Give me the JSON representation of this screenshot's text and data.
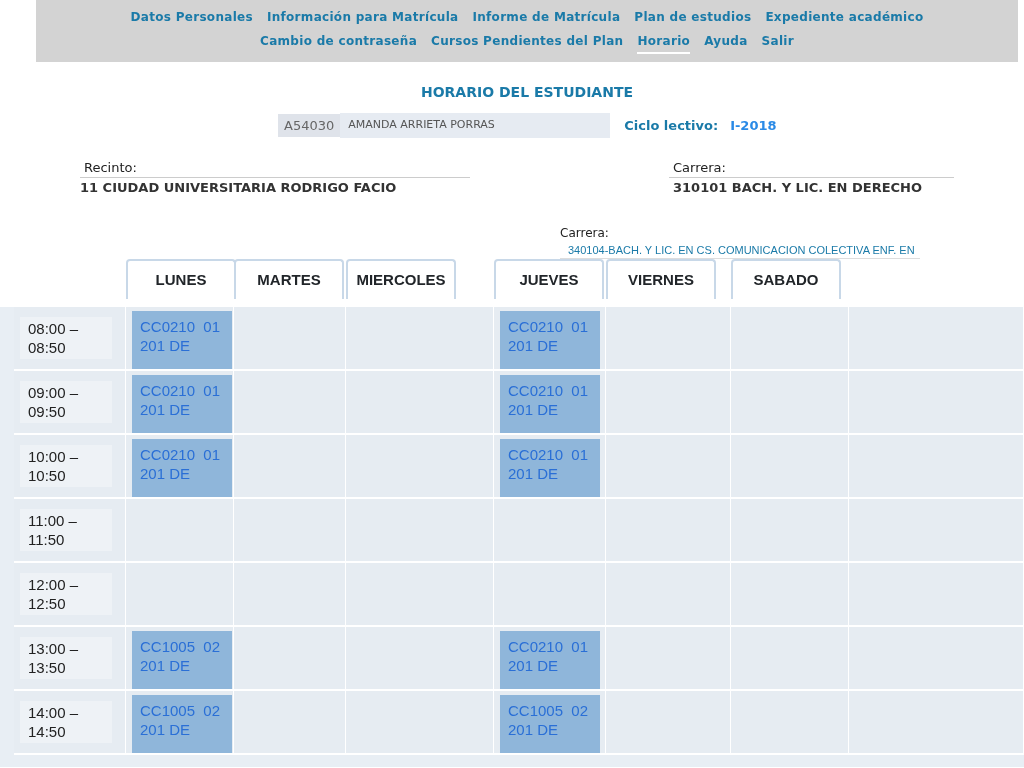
{
  "nav": {
    "items": [
      {
        "label": "Datos Personales",
        "selected": false
      },
      {
        "label": "Información para Matrícula",
        "selected": false
      },
      {
        "label": "Informe de Matrícula",
        "selected": false
      },
      {
        "label": "Plan de estudios",
        "selected": false
      },
      {
        "label": "Expediente académico",
        "selected": false
      },
      {
        "label": "Cambio de contraseña",
        "selected": false
      },
      {
        "label": "Cursos Pendientes del Plan",
        "selected": false
      },
      {
        "label": "Horario",
        "selected": true
      },
      {
        "label": "Ayuda",
        "selected": false
      },
      {
        "label": "Salir",
        "selected": false
      }
    ]
  },
  "title": "HORARIO DEL ESTUDIANTE",
  "student": {
    "id": "A54030",
    "name": "AMANDA ARRIETA PORRAS"
  },
  "cycle": {
    "label": "Ciclo lectivo:",
    "value": "I-2018"
  },
  "recinto": {
    "label": "Recinto:",
    "value": "11 CIUDAD UNIVERSITARIA RODRIGO FACIO"
  },
  "carrera": {
    "label": "Carrera:",
    "value": "310101 BACH. Y LIC. EN DERECHO"
  },
  "carrera2": {
    "label": "Carrera:",
    "value": "340104-BACH. Y LIC. EN CS. COMUNICACION COLECTIVA ENF. EN"
  },
  "days": [
    "LUNES",
    "MARTES",
    "MIERCOLES",
    "JUEVES",
    "VIERNES",
    "SABADO"
  ],
  "rows": [
    {
      "time": "08:00 – 08:50",
      "cells": [
        {
          "course": "CC0210  01",
          "room": "201 DE"
        },
        {},
        {},
        {
          "course": "CC0210  01",
          "room": "201 DE"
        },
        {},
        {}
      ]
    },
    {
      "time": "09:00 – 09:50",
      "cells": [
        {
          "course": "CC0210  01",
          "room": "201 DE"
        },
        {},
        {},
        {
          "course": "CC0210  01",
          "room": "201 DE"
        },
        {},
        {}
      ]
    },
    {
      "time": "10:00 – 10:50",
      "cells": [
        {
          "course": "CC0210  01",
          "room": "201 DE"
        },
        {},
        {},
        {
          "course": "CC0210  01",
          "room": "201 DE"
        },
        {},
        {}
      ]
    },
    {
      "time": "11:00 – 11:50",
      "cells": [
        {},
        {},
        {},
        {},
        {},
        {}
      ]
    },
    {
      "time": "12:00 – 12:50",
      "cells": [
        {},
        {},
        {},
        {},
        {},
        {}
      ]
    },
    {
      "time": "13:00 – 13:50",
      "cells": [
        {
          "course": "CC1005  02",
          "room": "201 DE"
        },
        {},
        {},
        {
          "course": "CC0210  01",
          "room": "201 DE"
        },
        {},
        {}
      ]
    },
    {
      "time": "14:00 – 14:50",
      "cells": [
        {
          "course": "CC1005  02",
          "room": "201 DE"
        },
        {},
        {},
        {
          "course": "CC1005  02",
          "room": "201 DE"
        },
        {},
        {}
      ]
    }
  ]
}
